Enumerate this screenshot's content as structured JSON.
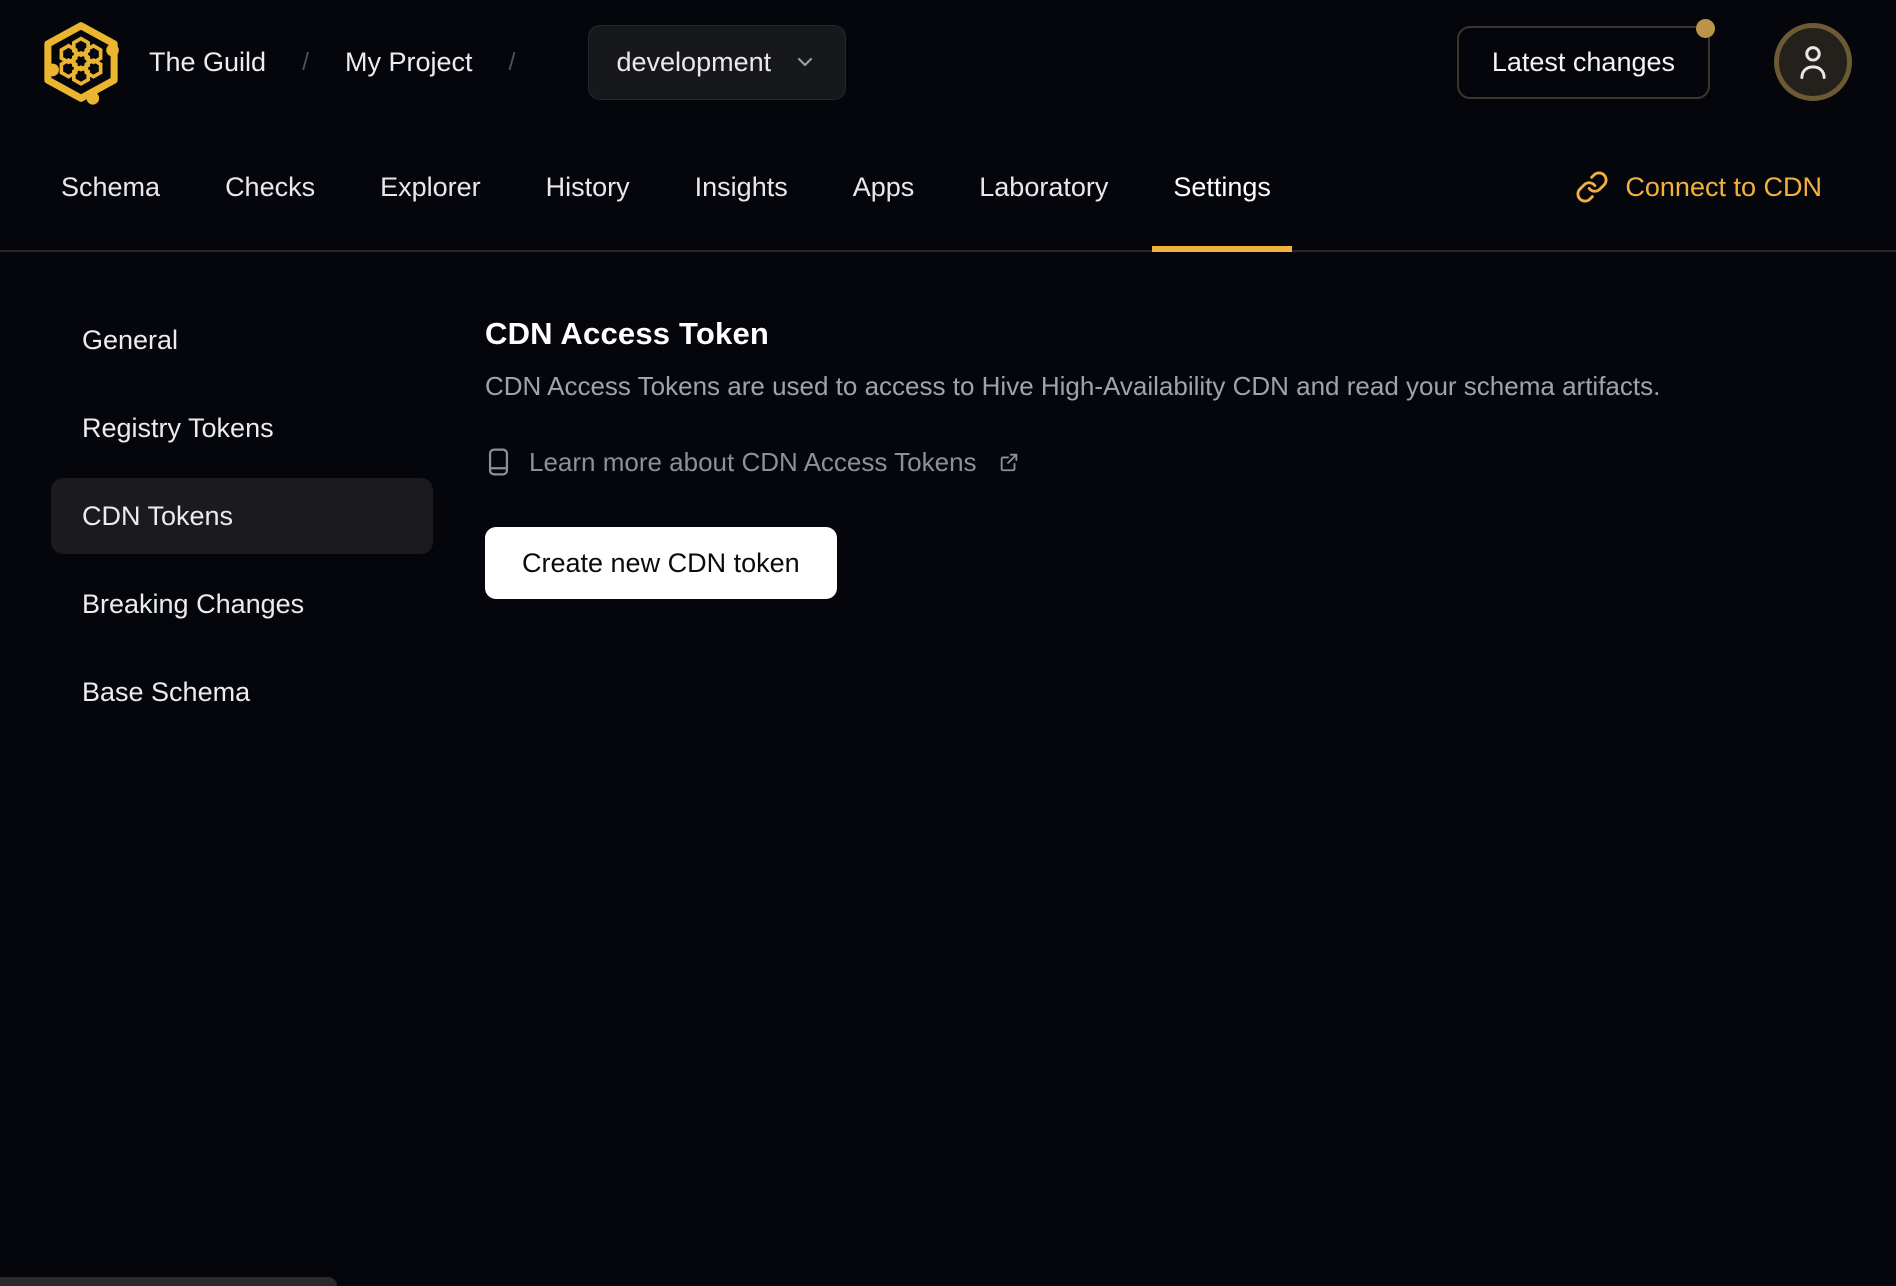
{
  "colors": {
    "background": "#04060c",
    "accent_amber": "#f0b23e",
    "link_amber": "#f3b13c",
    "logo_gold": "#ecb52f",
    "notification_dot": "#b9944a",
    "avatar_ring": "#6b5a33",
    "active_item_bg": "#1b1b1d",
    "button_bg": "#ffffff"
  },
  "header": {
    "logo_icon": "guild-hive-honeycomb-logo",
    "breadcrumb": {
      "separator": "/",
      "items": [
        "The Guild",
        "My Project"
      ]
    },
    "target_selector": {
      "value": "development",
      "chevron_icon": "chevron-down-icon"
    },
    "latest_changes": {
      "label": "Latest changes",
      "has_notification_dot": true
    },
    "avatar": {
      "icon": "user-icon"
    }
  },
  "nav": {
    "tabs": [
      {
        "label": "Schema"
      },
      {
        "label": "Checks"
      },
      {
        "label": "Explorer"
      },
      {
        "label": "History"
      },
      {
        "label": "Insights"
      },
      {
        "label": "Apps"
      },
      {
        "label": "Laboratory"
      },
      {
        "label": "Settings"
      }
    ],
    "active_tab": "Settings",
    "connect_cdn": {
      "label": "Connect to CDN",
      "icon": "link-icon"
    }
  },
  "sidebar": {
    "items": [
      {
        "label": "General"
      },
      {
        "label": "Registry Tokens"
      },
      {
        "label": "CDN Tokens"
      },
      {
        "label": "Breaking Changes"
      },
      {
        "label": "Base Schema"
      }
    ],
    "active_item": "CDN Tokens"
  },
  "main": {
    "title": "CDN Access Token",
    "description": "CDN Access Tokens are used to access to Hive High-Availability CDN and read your schema artifacts.",
    "learn_more": {
      "label": "Learn more about CDN Access Tokens",
      "leading_icon": "book-icon",
      "trailing_icon": "external-link-icon"
    },
    "create_button": {
      "label": "Create new CDN token"
    }
  }
}
